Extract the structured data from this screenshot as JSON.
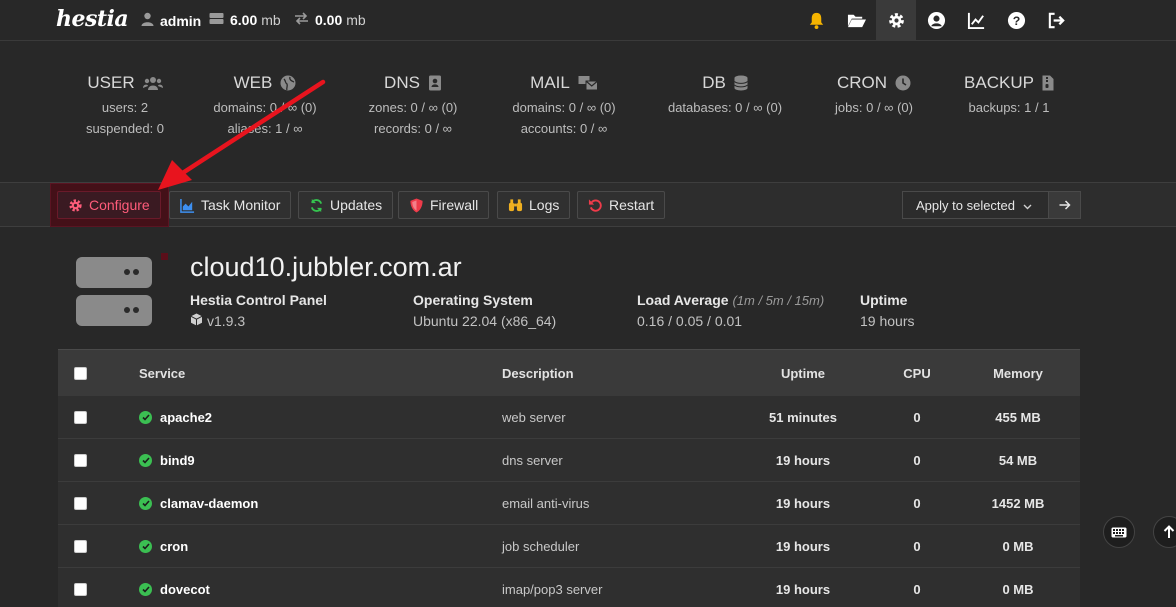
{
  "topbar": {
    "logo": "hestia",
    "user": "admin",
    "disk": "6.00",
    "disk_unit": "mb",
    "bandwidth": "0.00",
    "bandwidth_unit": "mb",
    "icons": [
      "bell-icon",
      "folder-open-icon",
      "gear-icon",
      "user-circle-icon",
      "chart-line-icon",
      "help-icon",
      "logout-icon"
    ]
  },
  "stats": [
    {
      "key": "user",
      "title": "USER",
      "icon": "users-icon",
      "lines": [
        "users: 2",
        "suspended: 0"
      ]
    },
    {
      "key": "web",
      "title": "WEB",
      "icon": "globe-icon",
      "lines": [
        "domains: 0 / ∞ (0)",
        "aliases: 1 / ∞"
      ]
    },
    {
      "key": "dns",
      "title": "DNS",
      "icon": "address-book-icon",
      "lines": [
        "zones: 0 / ∞ (0)",
        "records: 0 / ∞"
      ]
    },
    {
      "key": "mail",
      "title": "MAIL",
      "icon": "mail-bulk-icon",
      "lines": [
        "domains: 0 / ∞ (0)",
        "accounts: 0 / ∞"
      ]
    },
    {
      "key": "db",
      "title": "DB",
      "icon": "database-icon",
      "lines": [
        "databases: 0 / ∞ (0)"
      ]
    },
    {
      "key": "cron",
      "title": "CRON",
      "icon": "clock-icon",
      "lines": [
        "jobs: 0 / ∞ (0)"
      ]
    },
    {
      "key": "backup",
      "title": "BACKUP",
      "icon": "file-archive-icon",
      "lines": [
        "backups: 1 / 1"
      ]
    }
  ],
  "toolbar": {
    "configure": "Configure",
    "task_monitor": "Task Monitor",
    "updates": "Updates",
    "firewall": "Firewall",
    "logs": "Logs",
    "restart": "Restart",
    "apply_selected": "Apply to selected"
  },
  "server": {
    "hostname": "cloud10.jubbler.com.ar",
    "panel_label": "Hestia Control Panel",
    "panel_version": "v1.9.3",
    "os_label": "Operating System",
    "os_value": "Ubuntu 22.04 (x86_64)",
    "load_label": "Load Average",
    "load_sub": "(1m / 5m / 15m)",
    "load_value": "0.16 / 0.05 / 0.01",
    "uptime_label": "Uptime",
    "uptime_value": "19 hours"
  },
  "table": {
    "headers": {
      "service": "Service",
      "description": "Description",
      "uptime": "Uptime",
      "cpu": "CPU",
      "memory": "Memory"
    },
    "rows": [
      {
        "service": "apache2",
        "description": "web server",
        "uptime": "51 minutes",
        "cpu": "0",
        "memory": "455 MB"
      },
      {
        "service": "bind9",
        "description": "dns server",
        "uptime": "19 hours",
        "cpu": "0",
        "memory": "54 MB"
      },
      {
        "service": "clamav-daemon",
        "description": "email anti-virus",
        "uptime": "19 hours",
        "cpu": "0",
        "memory": "1452 MB"
      },
      {
        "service": "cron",
        "description": "job scheduler",
        "uptime": "19 hours",
        "cpu": "0",
        "memory": "0 MB"
      },
      {
        "service": "dovecot",
        "description": "imap/pop3 server",
        "uptime": "19 hours",
        "cpu": "0",
        "memory": "0 MB"
      }
    ]
  },
  "colors": {
    "background": "#282828",
    "accent_red": "#ff5c7a",
    "status_ok": "#3bbf52",
    "annotation_arrow": "#e8141e"
  }
}
